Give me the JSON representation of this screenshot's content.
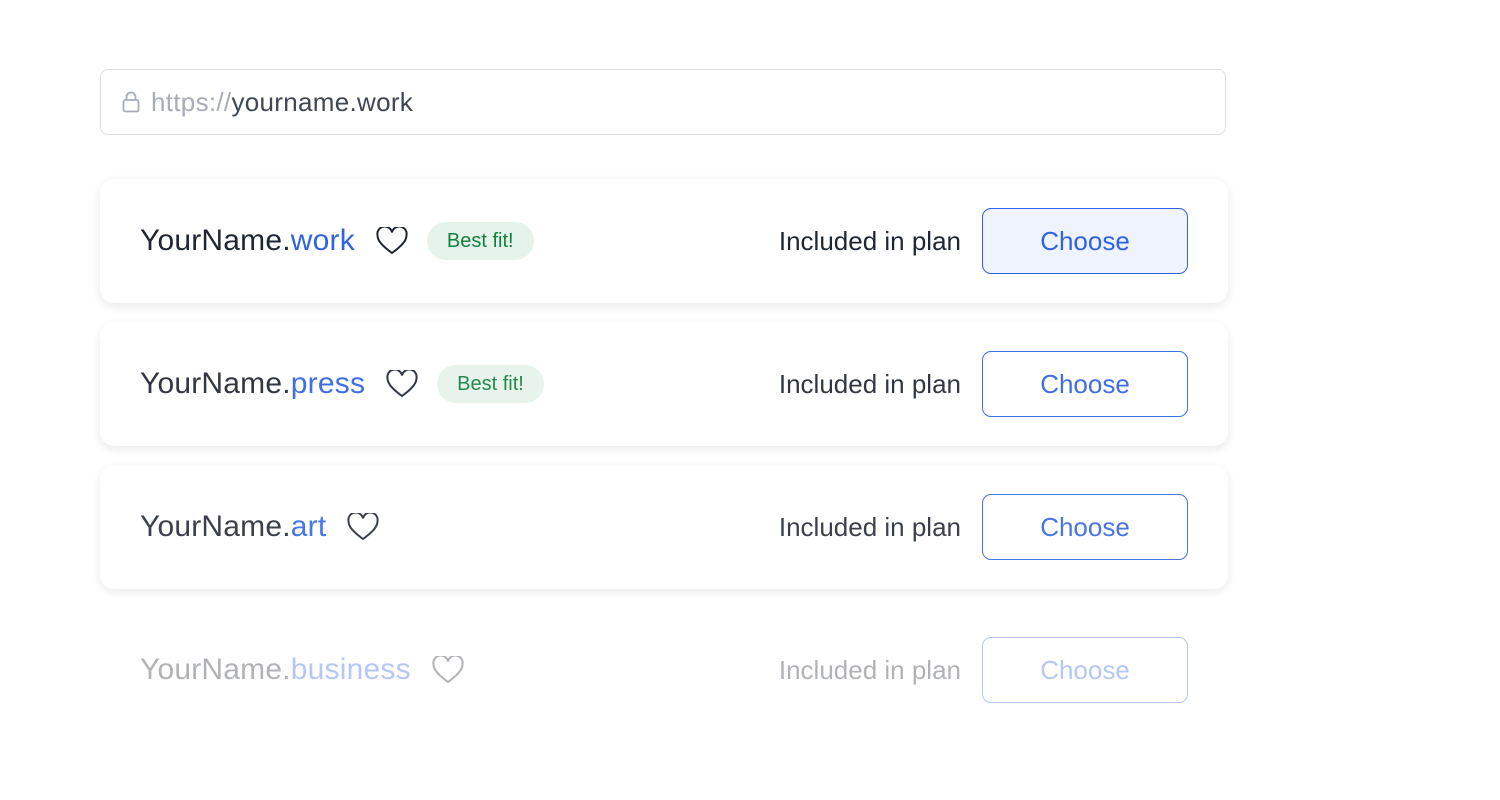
{
  "url_bar": {
    "scheme": "https://",
    "host": "yourname.work",
    "lock_icon": "lock-icon"
  },
  "colors": {
    "accent": "#2f62e6",
    "badge_bg": "#e5f3ea",
    "badge_text": "#12813f",
    "text": "#1f2633",
    "muted": "#a6adb8"
  },
  "domains": [
    {
      "name": "YourName.",
      "tld": "work",
      "favorite_icon": "heart-icon",
      "badge": "Best fit!",
      "price_label": "Included in plan",
      "action_label": "Choose",
      "selected": true
    },
    {
      "name": "YourName.",
      "tld": "press",
      "favorite_icon": "heart-icon",
      "badge": "Best fit!",
      "price_label": "Included in plan",
      "action_label": "Choose",
      "selected": false
    },
    {
      "name": "YourName.",
      "tld": "art",
      "favorite_icon": "heart-icon",
      "badge": "",
      "price_label": "Included in plan",
      "action_label": "Choose",
      "selected": false
    },
    {
      "name": "YourName.",
      "tld": "business",
      "favorite_icon": "heart-icon",
      "badge": "",
      "price_label": "Included in plan",
      "action_label": "Choose",
      "selected": false
    }
  ]
}
